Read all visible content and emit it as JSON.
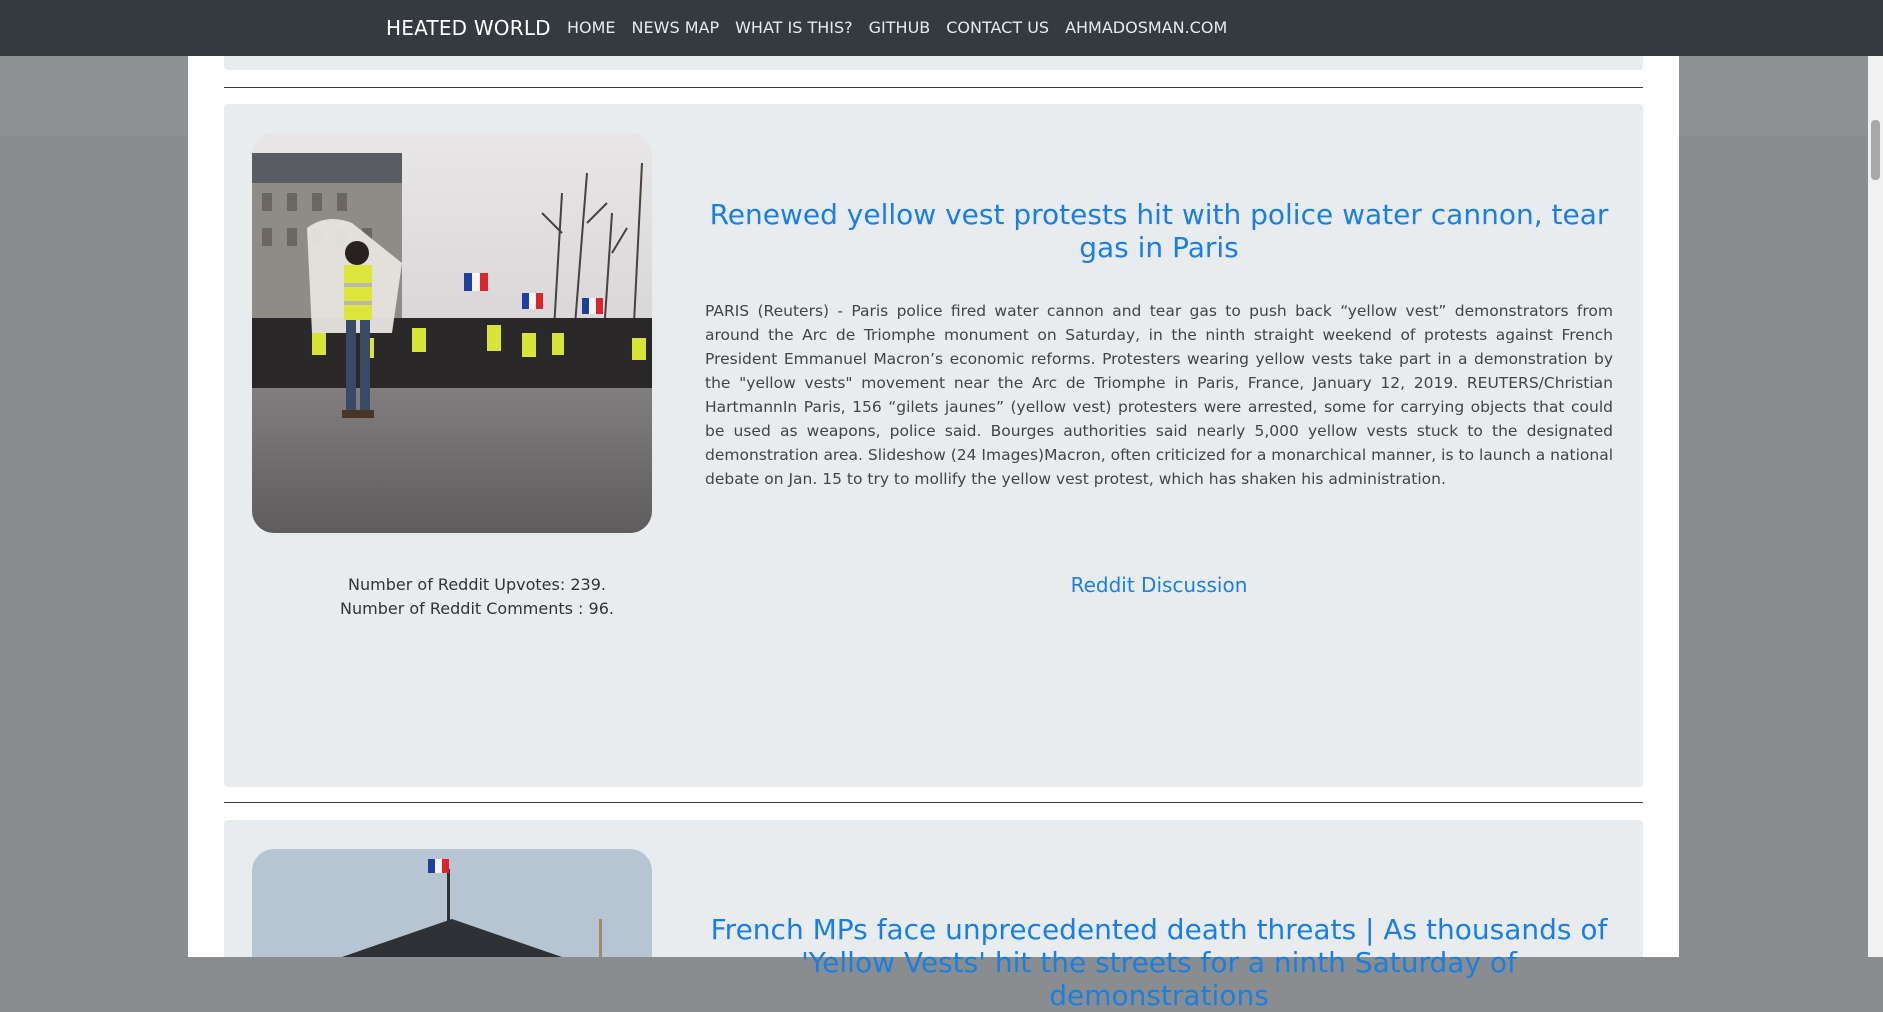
{
  "navbar": {
    "brand": "HEATED WORLD",
    "links": [
      "HOME",
      "NEWS MAP",
      "WHAT IS THIS?",
      "GITHUB",
      "CONTACT US",
      "AHMADOSMAN.COM"
    ]
  },
  "articles": [
    {
      "title": "Renewed yellow vest protests hit with police water cannon, tear gas in Paris",
      "body": "PARIS (Reuters) - Paris police fired water cannon and tear gas to push back “yellow vest” demonstrators from around the Arc de Triomphe monument on Saturday, in the ninth straight weekend of protests against French President Emmanuel Macron’s economic reforms. Protesters wearing yellow vests take part in a demonstration by the \"yellow vests\" movement near the Arc de Triomphe in Paris, France, January 12, 2019. REUTERS/Christian HartmannIn Paris, 156 “gilets jaunes” (yellow vest) protesters were arrested, some for carrying objects that could be used as weapons, police said. Bourges authorities said nearly 5,000 yellow vests stuck to the designated demonstration area. Slideshow (24 Images)Macron, often criticized for a monarchical manner, is to launch a national debate on Jan. 15 to try to mollify the yellow vest protest, which has shaken his administration.",
      "upvotes": "Number of Reddit Upvotes: 239.",
      "comments": "Number of Reddit Comments : 96.",
      "link": "Reddit Discussion"
    },
    {
      "title": "French MPs face unprecedented death threats | As thousands of 'Yellow Vests' hit the streets for a ninth Saturday of demonstrations"
    }
  ]
}
